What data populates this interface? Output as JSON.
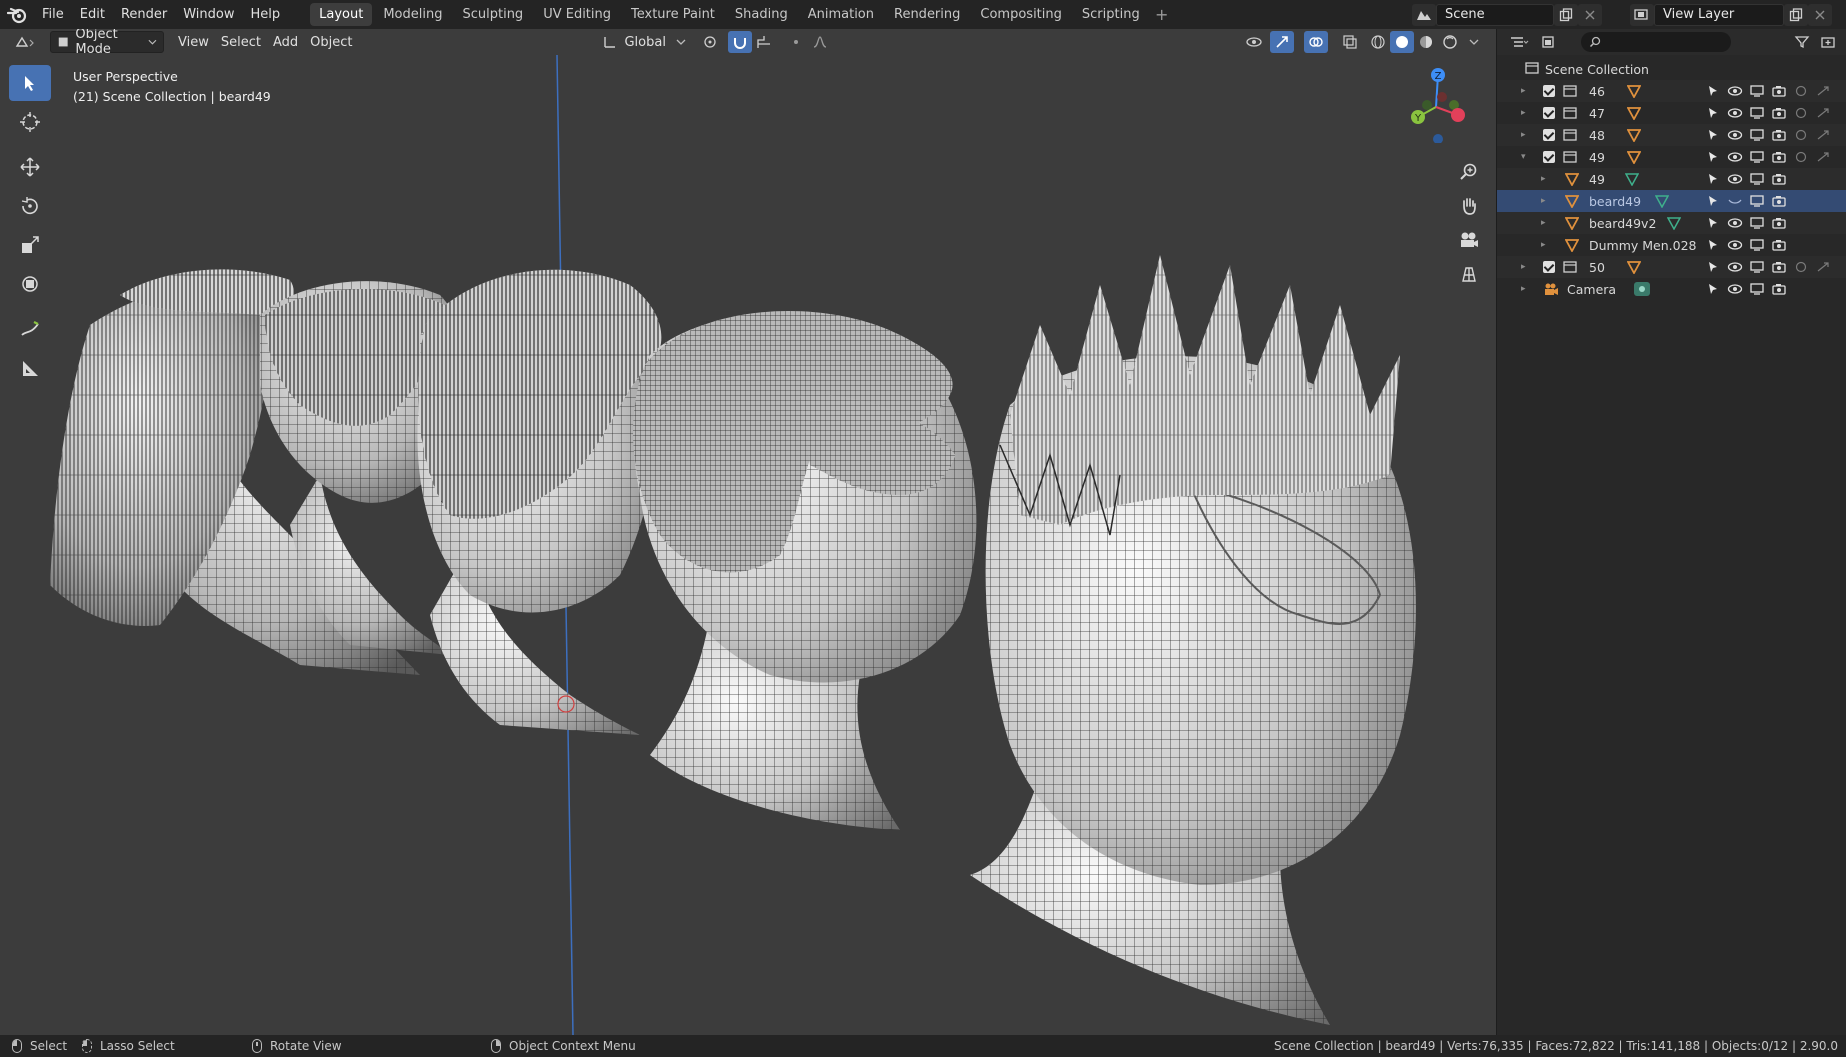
{
  "topbar": {
    "menus": [
      "File",
      "Edit",
      "Render",
      "Window",
      "Help"
    ],
    "workspaces": [
      "Layout",
      "Modeling",
      "Sculpting",
      "UV Editing",
      "Texture Paint",
      "Shading",
      "Animation",
      "Rendering",
      "Compositing",
      "Scripting"
    ],
    "active_workspace": "Layout",
    "add_tab": "+",
    "scene_name": "Scene",
    "view_layer_name": "View Layer"
  },
  "viewport": {
    "mode": "Object Mode",
    "menus": [
      "View",
      "Select",
      "Add",
      "Object"
    ],
    "transform_orientation": "Global",
    "info_line1": "User Perspective",
    "info_line2": "(21) Scene Collection | beard49",
    "gizmo_axes": {
      "z": "Z",
      "y": "Y",
      "x": "X"
    }
  },
  "outliner": {
    "root": "Scene Collection",
    "rows": [
      {
        "label": "46",
        "kind": "collection",
        "expanded": false,
        "indent": 0
      },
      {
        "label": "47",
        "kind": "collection",
        "expanded": false,
        "indent": 0
      },
      {
        "label": "48",
        "kind": "collection",
        "expanded": false,
        "indent": 0
      },
      {
        "label": "49",
        "kind": "collection",
        "expanded": true,
        "indent": 0
      },
      {
        "label": "49",
        "kind": "mesh",
        "indent": 1
      },
      {
        "label": "beard49",
        "kind": "mesh",
        "indent": 1,
        "selected": true
      },
      {
        "label": "beard49v2",
        "kind": "mesh",
        "indent": 1
      },
      {
        "label": "Dummy Men.028",
        "kind": "mesh",
        "indent": 1
      },
      {
        "label": "50",
        "kind": "collection",
        "expanded": false,
        "indent": 0
      },
      {
        "label": "Camera",
        "kind": "camera",
        "indent": 0
      }
    ]
  },
  "statusbar": {
    "select": "Select",
    "lasso": "Lasso Select",
    "rotate": "Rotate View",
    "context": "Object Context Menu",
    "stats": "Scene Collection | beard49 | Verts:76,335 | Faces:72,822 | Tris:141,188 | Objects:0/12 | 2.90.0"
  },
  "colors": {
    "accent": "#4772b3",
    "selected_row": "#344b73",
    "viewport_bg": "#3c3c3c",
    "mesh_icon": "#e0913d",
    "axis_x": "#e2405a",
    "axis_y": "#8ac43f",
    "axis_z": "#3d8ef7"
  }
}
